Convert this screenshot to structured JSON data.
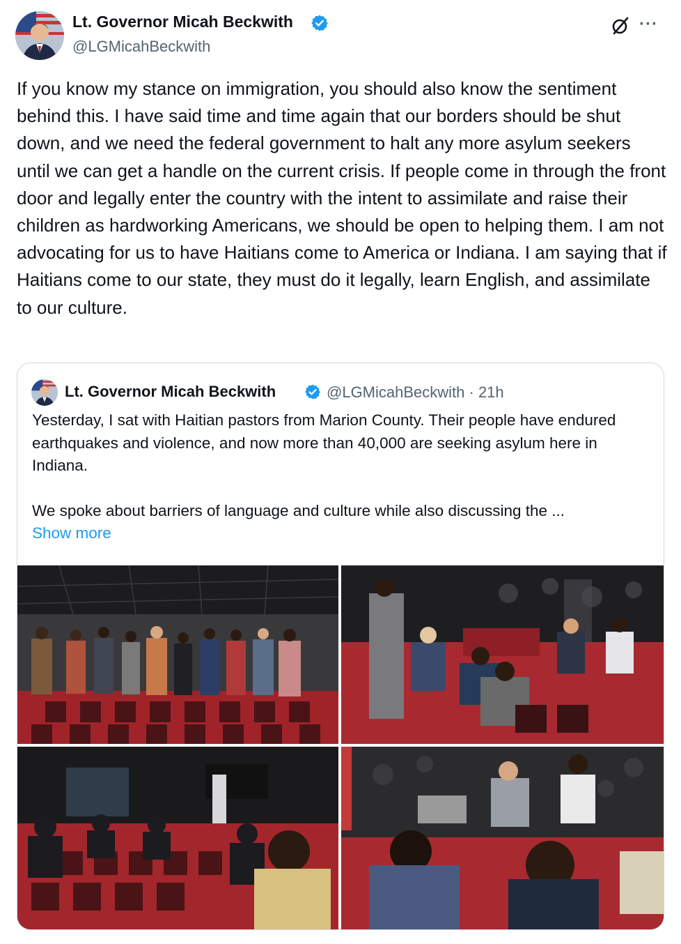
{
  "post": {
    "author_name": "Lt. Governor Micah Beckwith",
    "handle": "@LGMicahBeckwith",
    "verified": true,
    "text": "If you know my stance on immigration, you should also know the sentiment behind this. I have said time and time again that our borders should be shut down, and we need the federal government to halt any more asylum seekers until we can get a handle on the current crisis. If people come in through the front door and legally enter the country with the intent to assimilate and raise their children as hardworking Americans, we should be open to helping them. I am not advocating for us to have Haitians come to America or Indiana. I am saying that if Haitians come to our state, they must do it legally, learn English, and assimilate to our culture.",
    "more_label": "···"
  },
  "quote": {
    "author_name": "Lt. Governor Micah Beckwith",
    "meta": "@LGMicahBeckwith · 21h",
    "text": "Yesterday, I sat with Haitian pastors from Marion County. Their people have endured earthquakes and violence, and now more than 40,000 are seeking asylum here in Indiana.\n\nWe spoke about barriers of language and culture while also discussing the ...",
    "show_more": "Show more",
    "photos": [
      "group-photo",
      "meeting-photo",
      "audience-photo",
      "speaker-photo"
    ]
  },
  "colors": {
    "text": "#0f1419",
    "secondary": "#536471",
    "link": "#1d9bf0",
    "verified": "#1d9bf0",
    "border": "#cfd9de",
    "carpet": "#b0262b"
  },
  "icons": [
    "verified-badge-icon",
    "grok-icon",
    "more-icon"
  ]
}
